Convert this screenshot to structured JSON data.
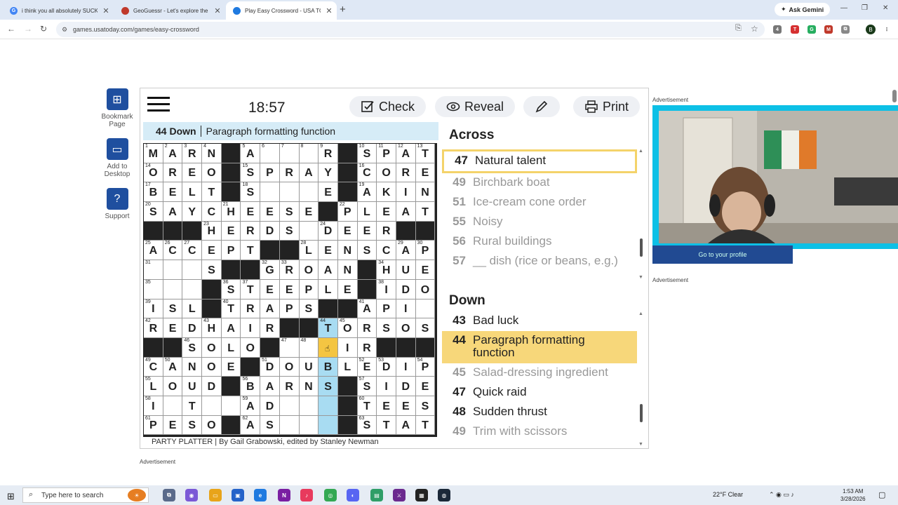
{
  "browser": {
    "tabs": [
      {
        "title": "i think you all absolutely SUCK",
        "favicon": "G",
        "favicon_color": "#4285f4"
      },
      {
        "title": "GeoGuessr - Let's explore the w",
        "favicon": "",
        "favicon_color": "#c0392b"
      },
      {
        "title": "Play Easy Crossword - USA TOD",
        "favicon": "",
        "favicon_color": "#1f7ae0"
      }
    ],
    "ask_gemini": "Ask Gemini",
    "url": "games.usatoday.com/games/easy-crossword",
    "profile_initial": "B"
  },
  "sidebar": {
    "bookmark": "Bookmark Page",
    "add_desktop": "Add to Desktop",
    "support": "Support"
  },
  "toolbar": {
    "timer": "18:57",
    "check": "Check",
    "reveal": "Reveal",
    "print": "Print"
  },
  "current_clue": {
    "label": "44 Down",
    "text": "Paragraph formatting function"
  },
  "grid": {
    "rows": [
      "MARN#A##R#SPAT",
      "OREO#SPRAY#CORE",
      "BELT#S###E#AKIN",
      "SAYCHEESE#PLEAT",
      "###HERDS#DEER##",
      "ACCEPT##LENSCAP",
      "###S##GROAN#HUE",
      "####STEEPLE#IDO",
      "ISL#TRAPS##API#",
      "REDHAIR##TORSOS",
      "##SOLO###IR####",
      "CANOE#DOUBLEDIP",
      "LOUD#BARNS#SIDE",
      "I#T#AD####TEES#",
      "PESO#AS####STAT"
    ]
  },
  "byline": "PARTY PLATTER | By Gail Grabowski, edited by Stanley Newman",
  "across": {
    "heading": "Across",
    "clues": [
      {
        "num": "47",
        "text": "Natural talent",
        "state": "boxed"
      },
      {
        "num": "49",
        "text": "Birchbark boat",
        "state": ""
      },
      {
        "num": "51",
        "text": "Ice-cream cone order",
        "state": ""
      },
      {
        "num": "55",
        "text": "Noisy",
        "state": ""
      },
      {
        "num": "56",
        "text": "Rural buildings",
        "state": ""
      },
      {
        "num": "57",
        "text": "__ dish (rice or beans, e.g.)",
        "state": ""
      }
    ]
  },
  "down": {
    "heading": "Down",
    "clues": [
      {
        "num": "43",
        "text": "Bad luck",
        "state": "current"
      },
      {
        "num": "44",
        "text": "Paragraph formatting function",
        "state": "selected"
      },
      {
        "num": "45",
        "text": "Salad-dressing ingredient",
        "state": ""
      },
      {
        "num": "47",
        "text": "Quick raid",
        "state": "current"
      },
      {
        "num": "48",
        "text": "Sudden thrust",
        "state": "current"
      },
      {
        "num": "49",
        "text": "Trim with scissors",
        "state": ""
      }
    ]
  },
  "ads": {
    "label": "Advertisement",
    "profile_button": "Go to your profile"
  },
  "taskbar": {
    "search_placeholder": "Type here to search",
    "weather": "22°F  Clear",
    "time": "1:53 AM",
    "date": "3/28/2026"
  },
  "colors": {
    "word_highlight": "#a8dcf2",
    "cursor_cell": "#f4c542",
    "selected_clue": "#f7d77a",
    "brand_blue": "#1f4f9f"
  }
}
